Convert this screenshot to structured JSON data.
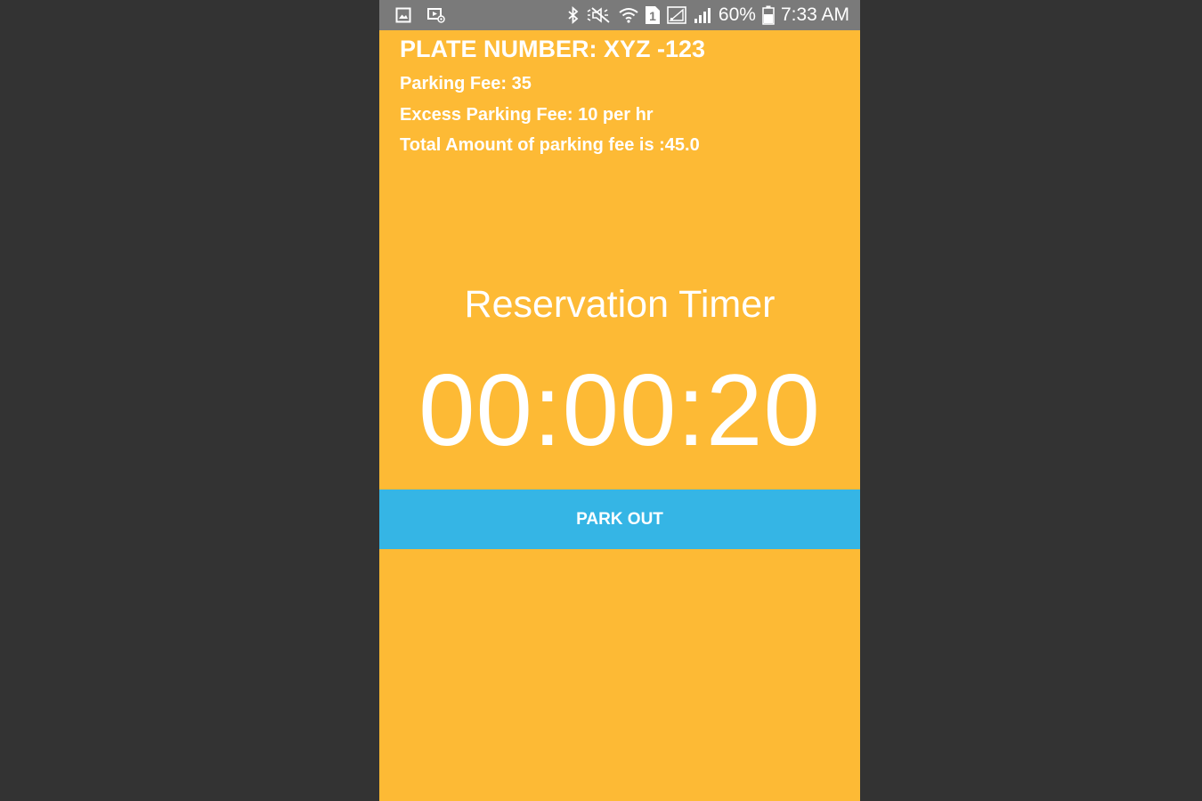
{
  "status_bar": {
    "icons_left": [
      "image-icon",
      "screencast-icon"
    ],
    "icons_right": [
      "bluetooth-icon",
      "mute-vibrate-icon",
      "wifi-icon",
      "sim-1-icon",
      "signal-empty-icon",
      "signal-icon",
      "battery-icon"
    ],
    "sim_label": "1",
    "battery_percent": "60%",
    "time": "7:33 AM"
  },
  "details": {
    "plate": "PLATE NUMBER: XYZ -123",
    "parking_fee": "Parking Fee: 35",
    "excess_fee": "Excess Parking Fee: 10 per hr",
    "total": "Total Amount of parking fee is :45.0"
  },
  "timer": {
    "label": "Reservation Timer",
    "value": "00:00:20"
  },
  "actions": {
    "park_out_label": "PARK OUT"
  },
  "colors": {
    "background": "#FDBA35",
    "button": "#35B5E5",
    "status_bar": "#7A7A7A",
    "outer": "#333333",
    "text": "#FFFFFF"
  }
}
